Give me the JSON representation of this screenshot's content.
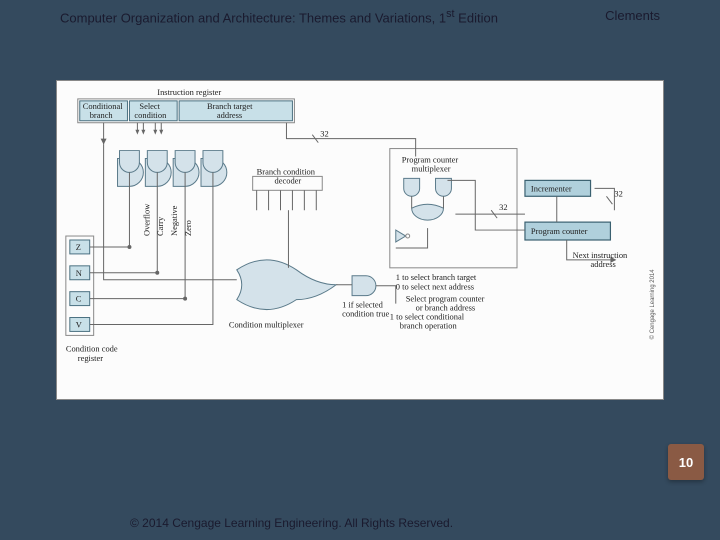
{
  "header": {
    "title_pre": "Computer Organization and Architecture: Themes and Variations, 1",
    "title_sup": "st",
    "title_post": " Edition",
    "author": "Clements"
  },
  "page_number": "10",
  "footer": "© 2014 Cengage Learning Engineering. All Rights Reserved.",
  "diagram": {
    "ir_title": "Instruction register",
    "ir_fields": [
      "Conditional branch",
      "Select condition",
      "Branch target address"
    ],
    "flags": [
      "Z",
      "N",
      "C",
      "V"
    ],
    "flag_names": [
      "Zero",
      "Negative",
      "Carry",
      "Overflow"
    ],
    "cond_reg": "Condition code register",
    "cond_mux": "Condition multiplexer",
    "branch_decoder": "Branch condition decoder",
    "sel_cond_true": "1 if selected condition true",
    "sel_cond_branch": "1 to select conditional branch operation",
    "pc_mux": "Program counter multiplexer",
    "sel_branch_target": "1 to select branch target",
    "sel_next_addr": "0 to select next address",
    "sel_pc_or_branch": "Select program counter or branch address",
    "incrementer": "Incrementer",
    "pc": "Program counter",
    "next_addr": "Next instruction address",
    "bus32a": "32",
    "bus32b": "32",
    "bus32c": "32",
    "copyright_side": "© Cengage Learning 2014"
  }
}
